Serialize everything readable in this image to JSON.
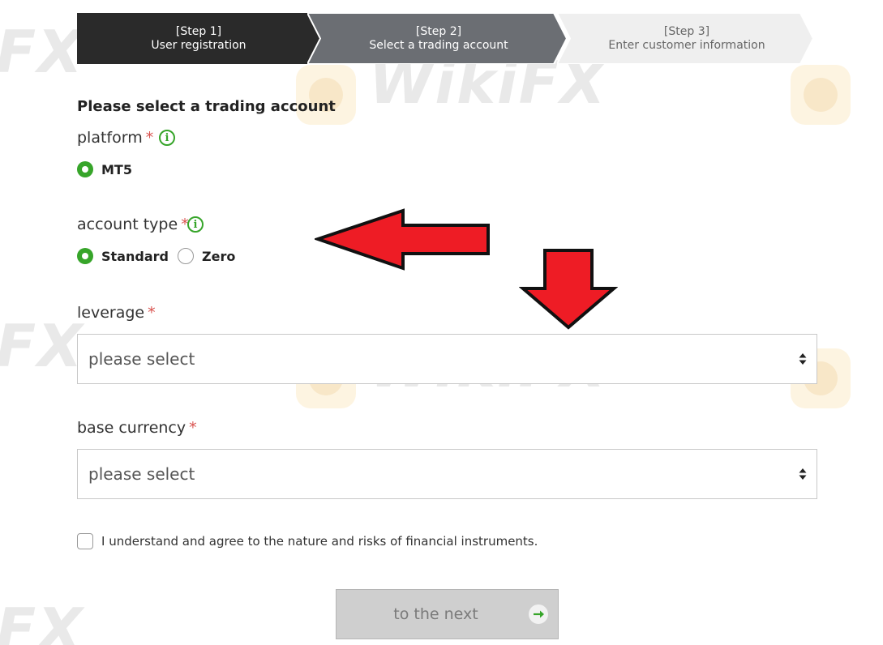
{
  "stepper": {
    "steps": [
      {
        "label": "[Step 1]",
        "sub": "User registration"
      },
      {
        "label": "[Step 2]",
        "sub": "Select a trading account"
      },
      {
        "label": "[Step 3]",
        "sub": "Enter customer information"
      }
    ]
  },
  "form": {
    "title": "Please select a trading account",
    "platform": {
      "label": "platform",
      "required_mark": "*",
      "info_icon": "i",
      "options": [
        "MT5"
      ],
      "selected": "MT5"
    },
    "account_type": {
      "label": "account type",
      "required_mark": "*",
      "info_icon": "i",
      "options": [
        "Standard",
        "Zero"
      ],
      "selected": "Standard"
    },
    "leverage": {
      "label": "leverage",
      "required_mark": "*",
      "value": "please select"
    },
    "base_currency": {
      "label": "base currency",
      "required_mark": "*",
      "value": "please select"
    },
    "agree_text": "I understand and agree to the nature and risks of financial instruments.",
    "agree_checked": false,
    "next_label": "to the next"
  },
  "watermark": {
    "text": "WikiFX",
    "partial_text": "FX"
  },
  "colors": {
    "accent": "#37a52a",
    "required": "#d9534f",
    "step_active": "#2a2a2a",
    "step_current": "#6b6e73",
    "step_future": "#efefef",
    "annotation_arrow": "#ee1c25"
  }
}
